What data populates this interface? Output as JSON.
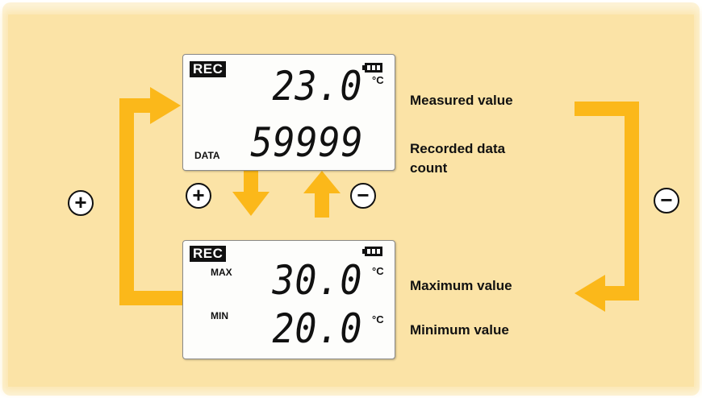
{
  "top_display": {
    "rec": "REC",
    "measured": "23.0",
    "measured_unit": "°C",
    "data_label": "DATA",
    "count": "59999"
  },
  "bottom_display": {
    "rec": "REC",
    "max_label": "MAX",
    "max_value": "30.0",
    "max_unit": "°C",
    "min_label": "MIN",
    "min_value": "20.0",
    "min_unit": "°C"
  },
  "labels": {
    "measured": "Measured value",
    "recorded_line1": "Recorded data",
    "recorded_line2": "count",
    "maximum": "Maximum value",
    "minimum": "Minimum value"
  },
  "buttons": {
    "plus": "+",
    "minus": "−"
  },
  "colors": {
    "panel": "#fbe3a6",
    "arrow": "#fbb81a"
  }
}
